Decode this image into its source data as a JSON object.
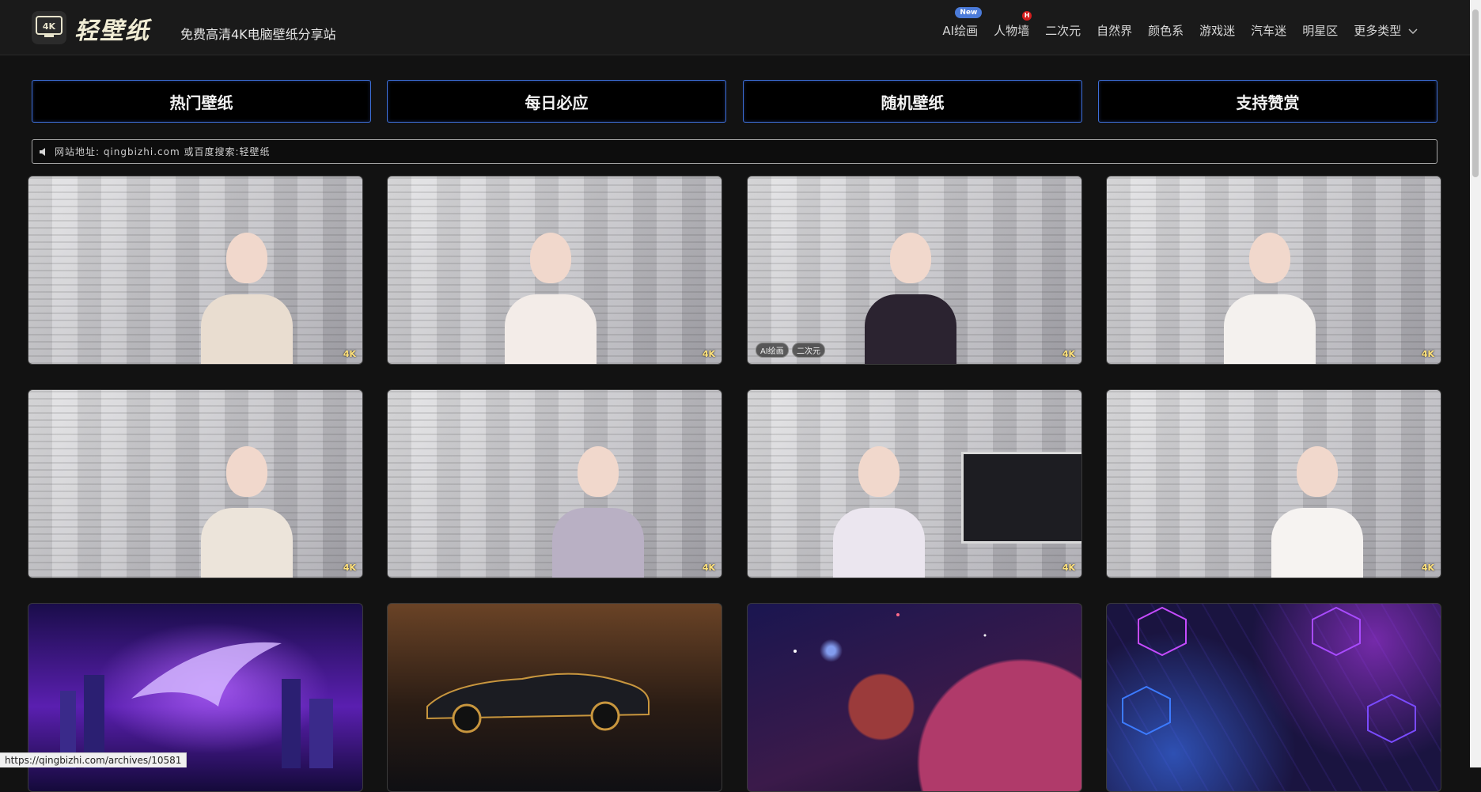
{
  "header": {
    "logo_badge": "4K",
    "logo_text": "轻壁纸",
    "slogan": "免费高清4K电脑壁纸分享站",
    "nav": [
      {
        "label": "AI绘画",
        "badge": "New"
      },
      {
        "label": "人物墙",
        "badge": "H"
      },
      {
        "label": "二次元"
      },
      {
        "label": "自然界"
      },
      {
        "label": "颜色系"
      },
      {
        "label": "游戏迷"
      },
      {
        "label": "汽车迷"
      },
      {
        "label": "明星区"
      },
      {
        "label": "更多类型",
        "icon": "chevron-down-icon"
      }
    ]
  },
  "actions": [
    "热门壁纸",
    "每日必应",
    "随机壁纸",
    "支持赞赏"
  ],
  "notice": {
    "icon": "speaker-icon",
    "text": "网站地址: qingbizhi.com 或百度搜索:轻壁纸"
  },
  "cards": [
    {
      "badge": "4K",
      "tags": []
    },
    {
      "badge": "4K",
      "tags": []
    },
    {
      "badge": "4K",
      "tags": [
        "AI绘画",
        "二次元"
      ]
    },
    {
      "badge": "4K",
      "tags": []
    },
    {
      "badge": "4K",
      "tags": []
    },
    {
      "badge": "4K",
      "tags": []
    },
    {
      "badge": "4K",
      "tags": []
    },
    {
      "badge": "4K",
      "tags": []
    },
    {
      "badge": "",
      "tags": []
    },
    {
      "badge": "",
      "tags": []
    },
    {
      "badge": "",
      "tags": []
    },
    {
      "badge": "",
      "tags": []
    }
  ],
  "status_bar": {
    "url": "https://qingbizhi.com/archives/10581"
  },
  "colors": {
    "accent_border": "#3d6fd8",
    "badge_new": "#4b7bd9",
    "badge_hot": "#d21d1d",
    "badge_4k": "#ffe17a"
  }
}
